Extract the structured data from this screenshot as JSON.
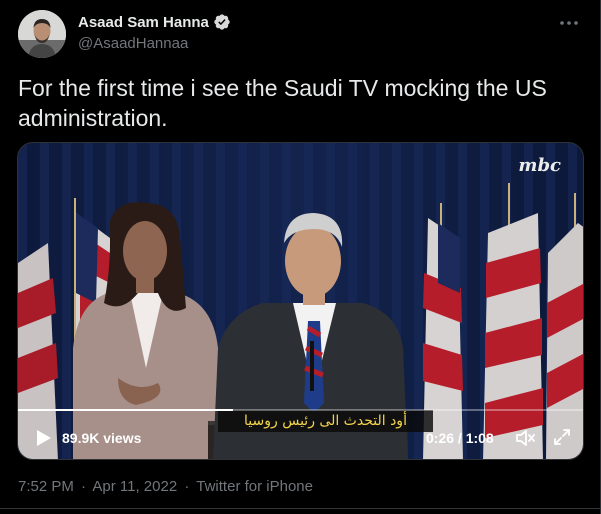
{
  "author": {
    "name": "Asaad Sam Hanna",
    "handle": "@AsaadHannaa",
    "verified": true,
    "avatar_icon": "avatar-photo"
  },
  "tweet": {
    "text": "For the first time i see the Saudi TV mocking the US administration."
  },
  "media": {
    "watermark": "mbc",
    "subtitle": "أود التحدث الى رئيس روسيا",
    "views": "89.9K views",
    "time": "0:26 / 1:08",
    "progress": 0.38,
    "controls": {
      "play_icon": "play-icon",
      "volume_icon": "volume-muted-icon",
      "fullscreen_icon": "fullscreen-icon"
    }
  },
  "meta": {
    "time": "7:52 PM",
    "date": "Apr 11, 2022",
    "source": "Twitter for iPhone",
    "separator": "·"
  },
  "colors": {
    "background": "#000000",
    "text": "#e7e9ea",
    "secondary": "#71767b",
    "border": "#2f3336",
    "verified": "#d9d9d9",
    "subtitle": "#f3d34a"
  }
}
